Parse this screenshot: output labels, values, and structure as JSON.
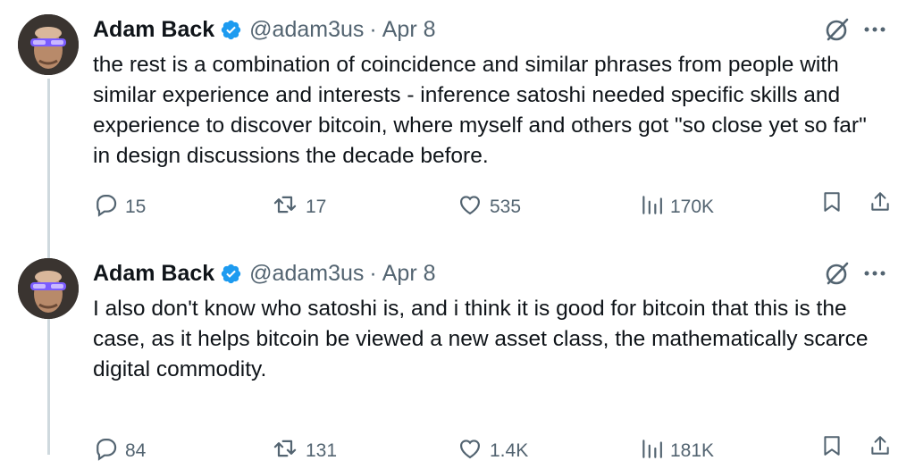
{
  "tweets": [
    {
      "author": "Adam Back",
      "handle": "@adam3us",
      "separator": "·",
      "date": "Apr 8",
      "text": "the rest is a combination of coincidence and similar phrases from people with similar experience and interests - inference satoshi needed specific skills and experience to discover bitcoin, where myself and others got \"so close yet so far\" in design discussions the decade before.",
      "replies": "15",
      "retweets": "17",
      "likes": "535",
      "views": "170K"
    },
    {
      "author": "Adam Back",
      "handle": "@adam3us",
      "separator": "·",
      "date": "Apr 8",
      "text": "I also don't know who satoshi is, and i think it is good for bitcoin that this is the case, as it helps bitcoin be viewed a new asset class, the mathematically scarce digital commodity.",
      "replies": "84",
      "retweets": "131",
      "likes": "1.4K",
      "views": "181K"
    }
  ],
  "icons": {
    "verified": "verified-badge-icon",
    "grok": "grok-icon",
    "more": "more-icon",
    "reply": "reply-icon",
    "retweet": "retweet-icon",
    "like": "like-icon",
    "views": "views-icon",
    "bookmark": "bookmark-icon",
    "share": "share-icon"
  },
  "colors": {
    "verified_blue": "#1d9bf0",
    "secondary_text": "#536471",
    "thread_line": "#cfd9de",
    "primary_text": "#0f1419"
  }
}
